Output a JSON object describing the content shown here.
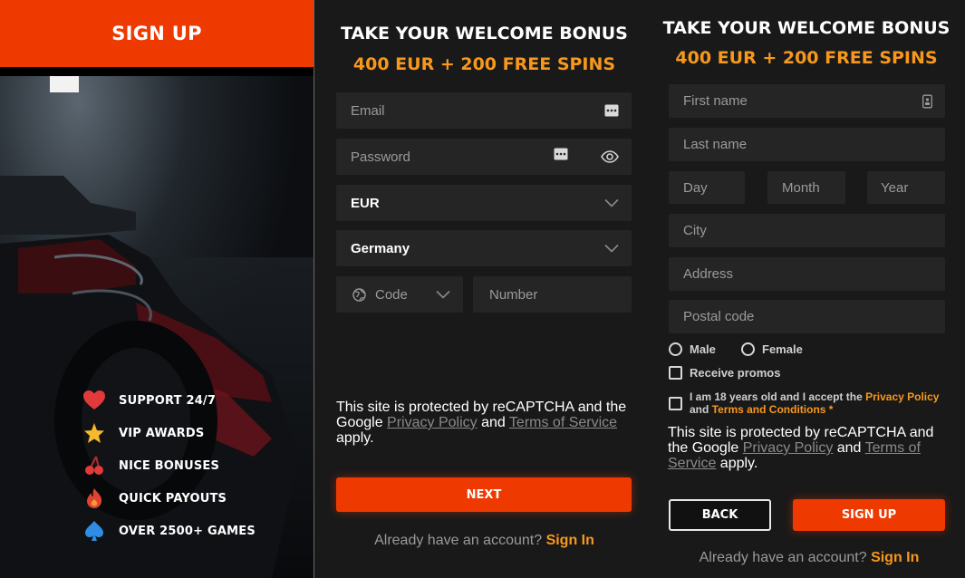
{
  "left": {
    "header": "SIGN UP",
    "features": [
      {
        "label": "SUPPORT 24/7",
        "icon": "heart-icon"
      },
      {
        "label": "VIP AWARDS",
        "icon": "star-icon"
      },
      {
        "label": "NICE BONUSES",
        "icon": "cherries-icon"
      },
      {
        "label": "QUICK PAYOUTS",
        "icon": "flame-icon"
      },
      {
        "label": "OVER 2500+ GAMES",
        "icon": "spade-icon"
      }
    ]
  },
  "step1": {
    "title": "TAKE YOUR WELCOME BONUS",
    "bonus": "400 EUR + 200 FREE SPINS",
    "email_placeholder": "Email",
    "password_placeholder": "Password",
    "currency": "EUR",
    "country": "Germany",
    "code_placeholder": "Code",
    "number_placeholder": "Number",
    "recaptcha": {
      "text1": "This site is protected by reCAPTCHA and the Google ",
      "privacy": "Privacy Policy",
      "and": " and ",
      "terms": "Terms of Service",
      "apply": " apply."
    },
    "next_button": "NEXT",
    "already": "Already have an account?",
    "signin": "Sign In"
  },
  "step2": {
    "title": "TAKE YOUR WELCOME BONUS",
    "bonus": "400 EUR + 200 FREE SPINS",
    "first_name": "First name",
    "last_name": "Last name",
    "day": "Day",
    "month": "Month",
    "year": "Year",
    "city": "City",
    "address": "Address",
    "postal_code": "Postal code",
    "male": "Male",
    "female": "Female",
    "receive_promos": "Receive promos",
    "age_text": "I am 18 years old and I accept the ",
    "privacy_policy": "Privacy Policy",
    "and": " and ",
    "terms_conditions": "Terms and Conditions",
    "required_mark": " *",
    "recaptcha": {
      "text1": "This site is protected by reCAPTCHA and the Google ",
      "privacy": "Privacy Policy",
      "and": " and ",
      "terms": "Terms of Service",
      "apply": " apply."
    },
    "back_button": "BACK",
    "signup_button": "SIGN UP",
    "already": "Already have an account?",
    "signin": "Sign In"
  },
  "colors": {
    "accent": "#ee3a00",
    "orange_text": "#f7981d",
    "field_bg": "#252525",
    "panel_bg": "#191919"
  }
}
